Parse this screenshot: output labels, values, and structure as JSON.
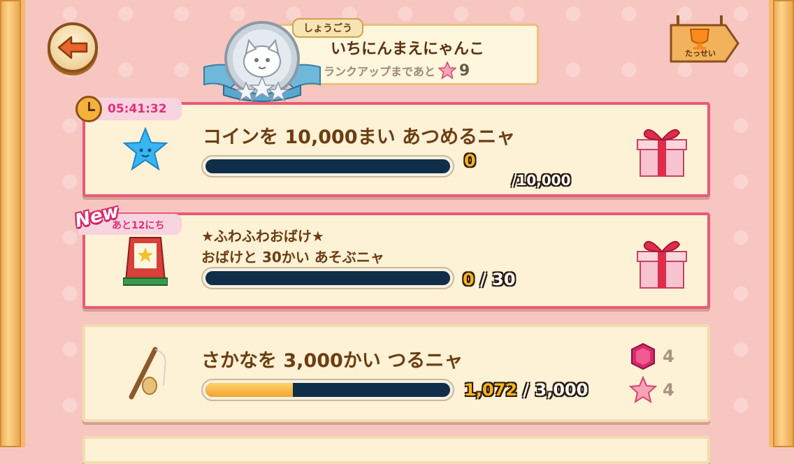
{
  "header": {
    "title_tag": "しょうごう",
    "title": "いちにんまえにゃんこ",
    "rank_up_text": "ランクアップまであと",
    "rank_up_count": "9",
    "trophy_label": "たっせい"
  },
  "missions": [
    {
      "timer": "05:41:32",
      "text": "コインを 10,000まい あつめるニャ",
      "progress": "0",
      "total": "/10,000",
      "progress_fraction": 0,
      "reward": "gift-box-icon"
    },
    {
      "badge": "New",
      "days_left": "あと12にち",
      "text_line1": "★ふわふわおばけ★",
      "text_line2": "おばけと 30かい あそぶニャ",
      "progress": "0",
      "total": " / 30",
      "progress_fraction": 0,
      "reward": "gift-box-icon"
    },
    {
      "text": "さかなを 3,000かい つるニャ",
      "progress": "1,072",
      "total": " / 3,000",
      "progress_fraction": 0.357,
      "rewards": [
        {
          "icon": "ruby-gem-icon",
          "count": "4"
        },
        {
          "icon": "pink-star-icon",
          "count": "4"
        }
      ]
    }
  ],
  "colors": {
    "accent_pink": "#e95a76",
    "progress_fill": "#f2a42e",
    "bar_track": "#0f2e4a"
  }
}
